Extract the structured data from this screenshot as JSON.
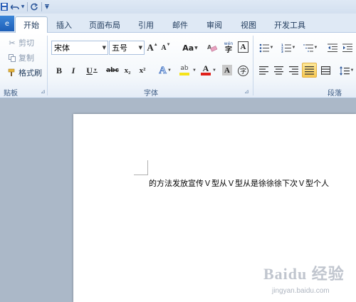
{
  "quick_access": {
    "save_icon": "save-icon",
    "undo_icon": "undo-icon",
    "redo_icon": "redo-icon",
    "customize_icon": "customize-quick-access-icon"
  },
  "tabs": {
    "file_label": "e",
    "items": [
      {
        "label": "开始",
        "active": true
      },
      {
        "label": "插入"
      },
      {
        "label": "页面布局"
      },
      {
        "label": "引用"
      },
      {
        "label": "邮件"
      },
      {
        "label": "审阅"
      },
      {
        "label": "视图"
      },
      {
        "label": "开发工具"
      }
    ]
  },
  "clipboard": {
    "cut_label": "剪切",
    "copy_label": "复制",
    "format_painter_label": "格式刷",
    "group_label": "贴板"
  },
  "font": {
    "font_name": "宋体",
    "font_size": "五号",
    "grow_label": "A",
    "shrink_label": "A",
    "change_case_label": "Aa",
    "bold": "B",
    "italic": "I",
    "underline": "U",
    "strikethrough": "abc",
    "subscript": "x₂",
    "superscript": "x²",
    "text_effects": "A",
    "highlight": "ab",
    "font_color": "A",
    "char_shading": "A",
    "enclose_char": "字",
    "phonetic": "wén",
    "group_label": "字体"
  },
  "paragraph": {
    "group_label": "段落"
  },
  "document": {
    "text": "的方法发放宣传Ｖ型从Ｖ型从是徐徐徐下次Ｖ型个人"
  },
  "watermark": {
    "brand": "Baidu 经验",
    "url": "jingyan.baidu.com"
  },
  "colors": {
    "highlight_yellow": "#f5e31a",
    "font_color_red": "#e0201b",
    "accent_blue": "#2a5599"
  }
}
